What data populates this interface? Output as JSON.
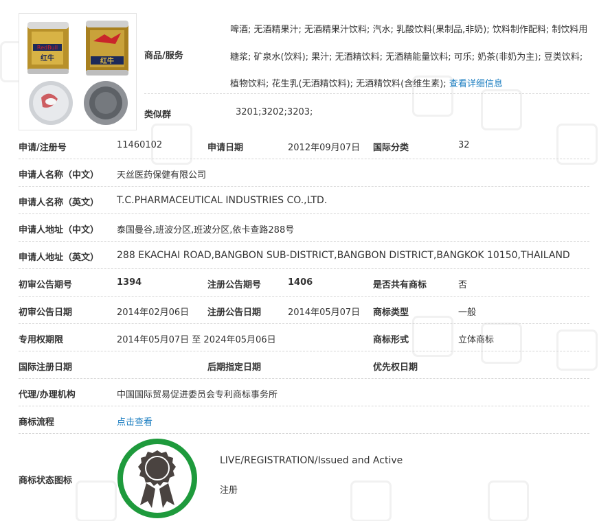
{
  "goods": {
    "label": "商品/服务",
    "text": "啤酒; 无酒精果汁; 无酒精果汁饮料; 汽水; 乳酸饮料(果制品,非奶); 饮料制作配料; 制饮料用糖浆; 矿泉水(饮料); 果汁; 无酒精饮料; 无酒精能量饮料; 可乐; 奶茶(非奶为主); 豆类饮料; 植物饮料; 花生乳(无酒精饮料); 无酒精饮料(含维生素);",
    "detail_link": "查看详细信息"
  },
  "similar_group": {
    "label": "类似群",
    "value": "3201;3202;3203;"
  },
  "product_image": {
    "can_text_en": "RedBull",
    "can_text_cn": "红牛"
  },
  "rows": {
    "reg_no": {
      "label": "申请/注册号",
      "value": "11460102"
    },
    "apply_date": {
      "label": "申请日期",
      "value": "2012年09月07日"
    },
    "intl_class": {
      "label": "国际分类",
      "value": "32"
    },
    "applicant_cn": {
      "label": "申请人名称（中文）",
      "value": "天丝医药保健有限公司"
    },
    "applicant_en": {
      "label": "申请人名称（英文）",
      "value": "T.C.PHARMACEUTICAL INDUSTRIES CO.,LTD."
    },
    "address_cn": {
      "label": "申请人地址（中文）",
      "value": "泰国曼谷,班波分区,班波分区,依卡查路288号"
    },
    "address_en": {
      "label": "申请人地址（英文）",
      "value": "288 EKACHAI ROAD,BANGBON SUB-DISTRICT,BANGBON DISTRICT,BANGKOK 10150,THAILAND"
    },
    "prelim_no": {
      "label": "初审公告期号",
      "value": "1394"
    },
    "reg_pub_no": {
      "label": "注册公告期号",
      "value": "1406"
    },
    "shared": {
      "label": "是否共有商标",
      "value": "否"
    },
    "prelim_date": {
      "label": "初审公告日期",
      "value": "2014年02月06日"
    },
    "reg_pub_date": {
      "label": "注册公告日期",
      "value": "2014年05月07日"
    },
    "mark_type": {
      "label": "商标类型",
      "value": "一般"
    },
    "exclusive_period": {
      "label": "专用权期限",
      "value": "2014年05月07日 至 2024年05月06日"
    },
    "mark_form": {
      "label": "商标形式",
      "value": "立体商标"
    },
    "intl_reg_date": {
      "label": "国际注册日期",
      "value": ""
    },
    "later_designation": {
      "label": "后期指定日期",
      "value": ""
    },
    "priority_date": {
      "label": "优先权日期",
      "value": ""
    },
    "agency": {
      "label": "代理/办理机构",
      "value": "中国国际贸易促进委员会专利商标事务所"
    },
    "process": {
      "label": "商标流程",
      "value": "点击查看"
    }
  },
  "status": {
    "label": "商标状态图标",
    "line1": "LIVE/REGISTRATION/Issued and Active",
    "line2": "注册",
    "ring_color": "#1e9a3c",
    "medal_color": "#4a4340"
  },
  "colors": {
    "link": "#1a7dc0",
    "divider": "#d6d6d6"
  }
}
